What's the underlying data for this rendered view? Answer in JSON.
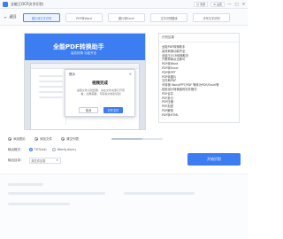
{
  "app": {
    "title": "全能王OCR文字识别",
    "logo_icon": "app-logo-icon"
  },
  "titlebar": {
    "login_label": "登录",
    "settings_label": "设置",
    "controls": [
      "—",
      "□",
      "✕"
    ]
  },
  "toolbar": {
    "back_label": "返回",
    "tabs": [
      {
        "label": "图片转文字识别",
        "active": true
      },
      {
        "label": "PDF转Word",
        "active": false
      },
      {
        "label": "图片转Excel",
        "active": false
      },
      {
        "label": "文字识别翻译",
        "active": false
      },
      {
        "label": "手写文字识别",
        "active": false
      }
    ]
  },
  "preview": {
    "banner_title": "全能PDF转换助手",
    "banner_subtitle": "高效转换 功能齐全"
  },
  "dialog": {
    "title": "提示",
    "heading": "视频完成",
    "message": "提取文件识别结果，请在文件夹里打开查看，如果需要，可取得文档到识别",
    "cancel_label": "取消",
    "confirm_label": "打开文件"
  },
  "right_panel": {
    "header": "识别结果",
    "items": [
      "全能PDF转换助手",
      "高效转换功能齐全",
      "全能王OCR转换助手",
      "只需简单点击即可",
      "PDF转Word",
      "PDF转Excel",
      "PDF转PPT",
      "PDF转图片",
      "文件转PDF",
      "可转换 Word/PPT/PDF 等转为PDF/Excel等",
      "轻松设计转换各种文件格式",
      "PDF合并",
      "PDF拆分",
      "PDF压缩",
      "PDF加密",
      "PDF解密",
      "PDF转HTML"
    ]
  },
  "actions": {
    "add_image": "添加图片",
    "add_folder": "添加文件",
    "clear_list": "清空列表",
    "slider_value": 0.6
  },
  "output_format": {
    "label": "输出格式：",
    "options": [
      {
        "label": "TXT(txt)",
        "checked": true
      },
      {
        "label": "Word(.docx)",
        "checked": false
      }
    ]
  },
  "output_dir": {
    "label": "输出目录：",
    "value": "原文件目录"
  },
  "start_button": "开始识别",
  "colors": {
    "accent": "#3d7cf2",
    "border": "#dde2e9"
  }
}
